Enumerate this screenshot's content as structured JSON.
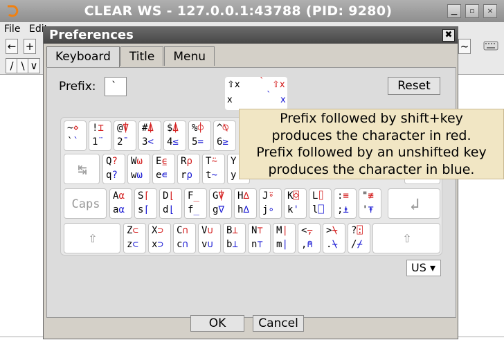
{
  "window": {
    "title": "CLEAR WS - 127.0.0.1:43788 (PID: 9280)"
  },
  "menu": {
    "file": "File",
    "edit": "Edit"
  },
  "toolbar": {
    "b1": "←",
    "b2": "+",
    "b3": "/",
    "b4": "\\",
    "b5": "∨",
    "b6": "/",
    "b7": "~"
  },
  "dialog": {
    "title": "Preferences",
    "close": "✖",
    "tabs": [
      "Keyboard",
      "Title",
      "Menu"
    ],
    "prefix_label": "Prefix:",
    "prefix_value": "`",
    "reset": "Reset",
    "legend": {
      "tl_top": "⇧x",
      "tl_bottom": "x",
      "r1": "`",
      "r2": "⇧x",
      "r3": "`",
      "r4": "x"
    },
    "layout": "US ▾",
    "ok": "OK",
    "cancel": "Cancel"
  },
  "tooltip": {
    "line1": "Prefix followed by shift+key",
    "line2": "produces the character in red.",
    "line3": "Prefix followed by an unshifted key",
    "line4": "produces the character in blue."
  },
  "special_keys": {
    "tab": "↹",
    "caps": "Caps",
    "enter": "↲",
    "shift_left": "⇧",
    "shift_right": "⇧"
  },
  "keyboard": {
    "row1": [
      {
        "tl": "~",
        "tr": "⋄",
        "bl": "`",
        "br": "`"
      },
      {
        "tl": "!",
        "tr": "⌶",
        "bl": "1",
        "br": "¨"
      },
      {
        "tl": "@",
        "tr": "⍒",
        "bl": "2",
        "br": "¯"
      },
      {
        "tl": "#",
        "tr": "⍋",
        "bl": "3",
        "br": "<"
      },
      {
        "tl": "$",
        "tr": "⍋",
        "bl": "4",
        "br": "≤"
      },
      {
        "tl": "%",
        "tr": "⌽",
        "bl": "5",
        "br": "="
      },
      {
        "tl": "^",
        "tr": "⍉",
        "bl": "6",
        "br": "≥"
      }
    ],
    "row2": [
      {
        "tl": "Q",
        "tr": "?",
        "bl": "q",
        "br": "?"
      },
      {
        "tl": "W",
        "tr": "⍵",
        "bl": "w",
        "br": "⍵"
      },
      {
        "tl": "E",
        "tr": "⍷",
        "bl": "e",
        "br": "∊"
      },
      {
        "tl": "R",
        "tr": "ρ",
        "bl": "r",
        "br": "ρ"
      },
      {
        "tl": "T",
        "tr": "⍨",
        "bl": "t",
        "br": "~"
      },
      {
        "tl": "Y",
        "tr": "",
        "bl": "y",
        "br": ""
      }
    ],
    "row3": [
      {
        "tl": "A",
        "tr": "⍺",
        "bl": "a",
        "br": "⍺"
      },
      {
        "tl": "S",
        "tr": "⌈",
        "bl": "s",
        "br": "⌈"
      },
      {
        "tl": "D",
        "tr": "⌊",
        "bl": "d",
        "br": "⌊"
      },
      {
        "tl": "F",
        "tr": "_",
        "bl": "f",
        "br": "_"
      },
      {
        "tl": "G",
        "tr": "⍒",
        "bl": "g",
        "br": "∇"
      },
      {
        "tl": "H",
        "tr": "∆",
        "bl": "h",
        "br": "∆"
      },
      {
        "tl": "J",
        "tr": "⍤",
        "bl": "j",
        "br": "∘"
      },
      {
        "tl": "K",
        "tr": "⌺",
        "bl": "k",
        "br": "'"
      },
      {
        "tl": "L",
        "tr": "⌷",
        "bl": "l",
        "br": "⎕"
      },
      {
        "tl": ":",
        "tr": "≡",
        "bl": ";",
        "br": "⍎"
      },
      {
        "tl": "\"",
        "tr": "≢",
        "bl": "'",
        "br": "⍕"
      }
    ],
    "row4": [
      {
        "tl": "Z",
        "tr": "⊂",
        "bl": "z",
        "br": "⊂"
      },
      {
        "tl": "X",
        "tr": "⊃",
        "bl": "x",
        "br": "⊃"
      },
      {
        "tl": "C",
        "tr": "∩",
        "bl": "c",
        "br": "∩"
      },
      {
        "tl": "V",
        "tr": "∪",
        "bl": "v",
        "br": "∪"
      },
      {
        "tl": "B",
        "tr": "⊥",
        "bl": "b",
        "br": "⊥"
      },
      {
        "tl": "N",
        "tr": "⊤",
        "bl": "n",
        "br": "⊤"
      },
      {
        "tl": "M",
        "tr": "|",
        "bl": "m",
        "br": "|"
      },
      {
        "tl": "<",
        "tr": "⍪",
        "bl": ",",
        "br": "⍝"
      },
      {
        "tl": ">",
        "tr": "⍀",
        "bl": ".",
        "br": "⍀"
      },
      {
        "tl": "?",
        "tr": "⍠",
        "bl": "/",
        "br": "⌿"
      }
    ]
  },
  "colors": {
    "shifted": "#d42020",
    "unshifted": "#1a1ad4",
    "tooltip_bg": "#f1e6c4"
  }
}
